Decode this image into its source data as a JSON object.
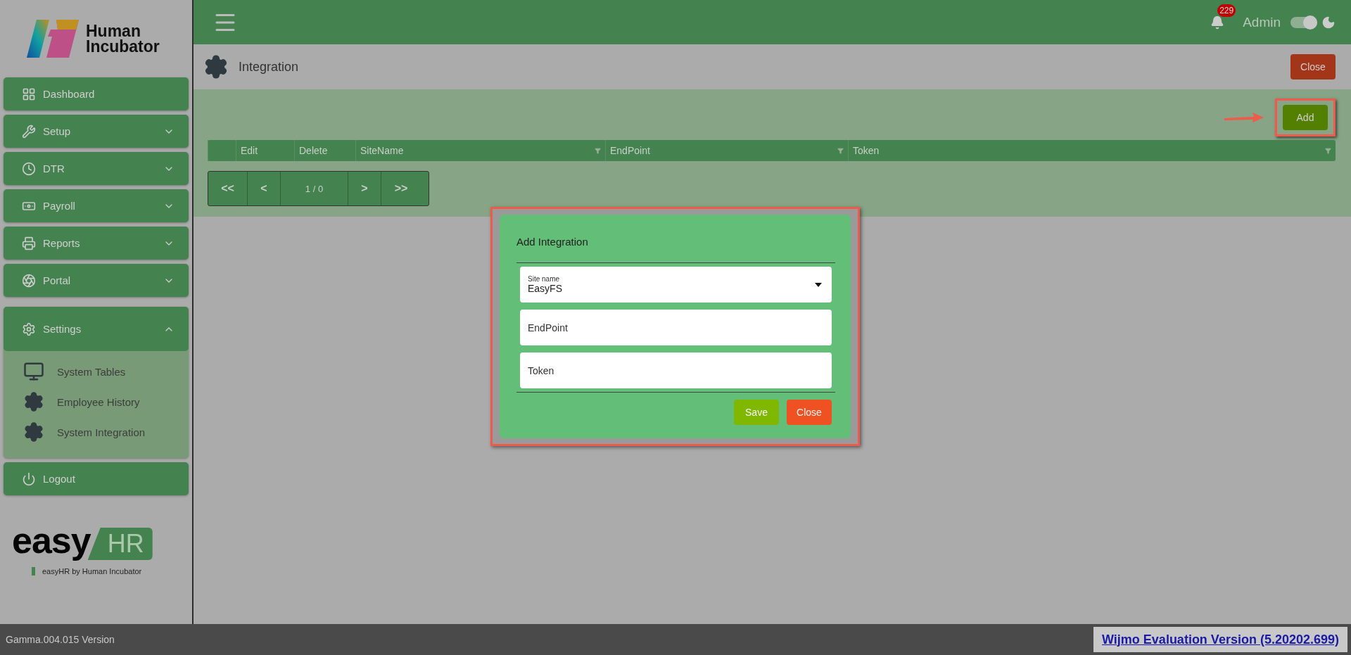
{
  "brand": {
    "line_1": "Human",
    "line_2": "Incubator"
  },
  "sidebar": {
    "menu": [
      {
        "label": "Dashboard"
      },
      {
        "label": "Setup",
        "expanded": false
      },
      {
        "label": "DTR",
        "expanded": false
      },
      {
        "label": "Payroll",
        "expanded": false
      },
      {
        "label": "Reports",
        "expanded": false
      },
      {
        "label": "Portal",
        "expanded": false
      },
      {
        "label": "Settings",
        "expanded": true,
        "children": [
          {
            "label": "System Tables"
          },
          {
            "label": "Employee History"
          },
          {
            "label": "System Integration"
          }
        ]
      }
    ],
    "logout": "Logout"
  },
  "product_logo": {
    "word": "easy",
    "tag": "HR",
    "tagline": "easyHR by Human Incubator"
  },
  "header": {
    "notifications": "229",
    "user": "Admin",
    "theme_switch": {
      "on": true
    }
  },
  "page": {
    "title": "Integration",
    "close_button": "Close",
    "add_button": "Add"
  },
  "table": {
    "columns": [
      {
        "filterable": false
      },
      {
        "label": "Edit",
        "filterable": false
      },
      {
        "label": "Delete",
        "filterable": false
      },
      {
        "label": "SiteName",
        "filterable": true
      },
      {
        "label": "EndPoint",
        "filterable": true
      },
      {
        "label": "Token",
        "filterable": true
      }
    ]
  },
  "pager": {
    "first": "<<",
    "previous": "<",
    "position": "1 / 0",
    "next": ">",
    "last": ">>"
  },
  "dialog": {
    "title": "Add Integration",
    "fields": [
      {
        "kind": "select",
        "label": "Site name",
        "value": "EasyFS"
      },
      {
        "kind": "input",
        "placeholder": "EndPoint"
      },
      {
        "kind": "input",
        "placeholder": "Token"
      }
    ],
    "buttons": [
      {
        "label": "Save",
        "kind": "primary"
      },
      {
        "label": "Close",
        "kind": "danger"
      }
    ]
  },
  "footer": {
    "version": "Gamma.004.015 Version",
    "notice": "Wijmo Evaluation Version (5.20202.699)"
  }
}
